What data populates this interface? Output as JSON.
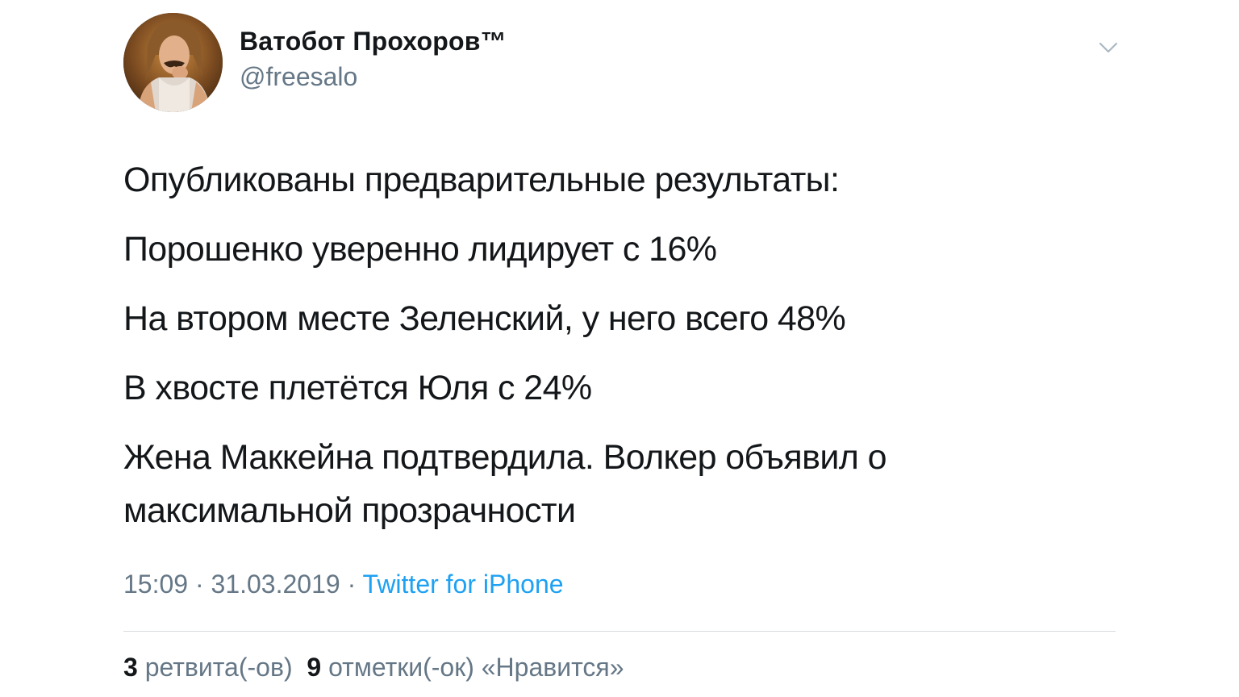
{
  "author": {
    "display_name": "Ватобот Прохоров™",
    "handle": "@freesalo",
    "avatar_icon": "person-portrait"
  },
  "tweet": {
    "lines": [
      "Опубликованы предварительные результаты:",
      "Порошенко уверенно лидирует с 16%",
      "На втором месте Зеленский, у него всего 48%",
      "В хвосте плетётся Юля с 24%",
      "Жена Маккейна подтвердила. Волкер объявил о максимальной прозрачности"
    ],
    "time": "15:09",
    "separator": " · ",
    "date": "31.03.2019",
    "source": "Twitter for iPhone"
  },
  "stats": {
    "retweets_count": "3",
    "retweets_label": "ретвита(-ов)",
    "likes_count": "9",
    "likes_label": "отметки(-ок) «Нравится»"
  },
  "colors": {
    "text": "#14171a",
    "secondary": "#657786",
    "link": "#1da1f2",
    "divider": "#d6dbe0"
  },
  "icons": {
    "menu": "chevron-down-icon"
  }
}
